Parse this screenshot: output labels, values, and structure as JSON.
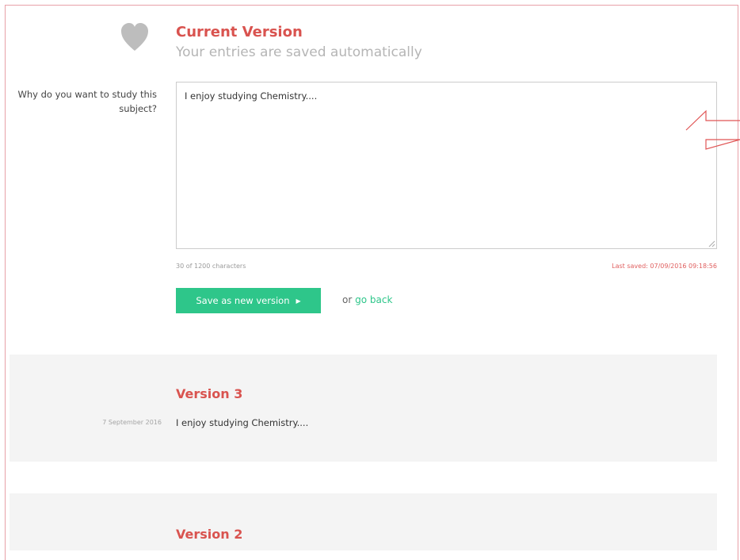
{
  "current": {
    "title": "Current Version",
    "subtitle": "Your entries are saved automatically",
    "icon": "heart-icon"
  },
  "question": {
    "label": "Why do you want to study this subject?",
    "answer": "I enjoy studying Chemistry...."
  },
  "meta": {
    "char_count": "30 of 1200 characters",
    "last_saved": "Last saved: 07/09/2016 09:18:56"
  },
  "actions": {
    "save_label": "Save as new version",
    "or_text": "or",
    "go_back_label": "go back"
  },
  "versions": [
    {
      "title": "Version 3",
      "date": "7 September 2016",
      "text": "I enjoy studying Chemistry...."
    },
    {
      "title": "Version 2"
    }
  ],
  "colors": {
    "accent_red": "#d9534f",
    "button_green": "#2ec68a",
    "panel_grey": "#f4f4f4"
  }
}
